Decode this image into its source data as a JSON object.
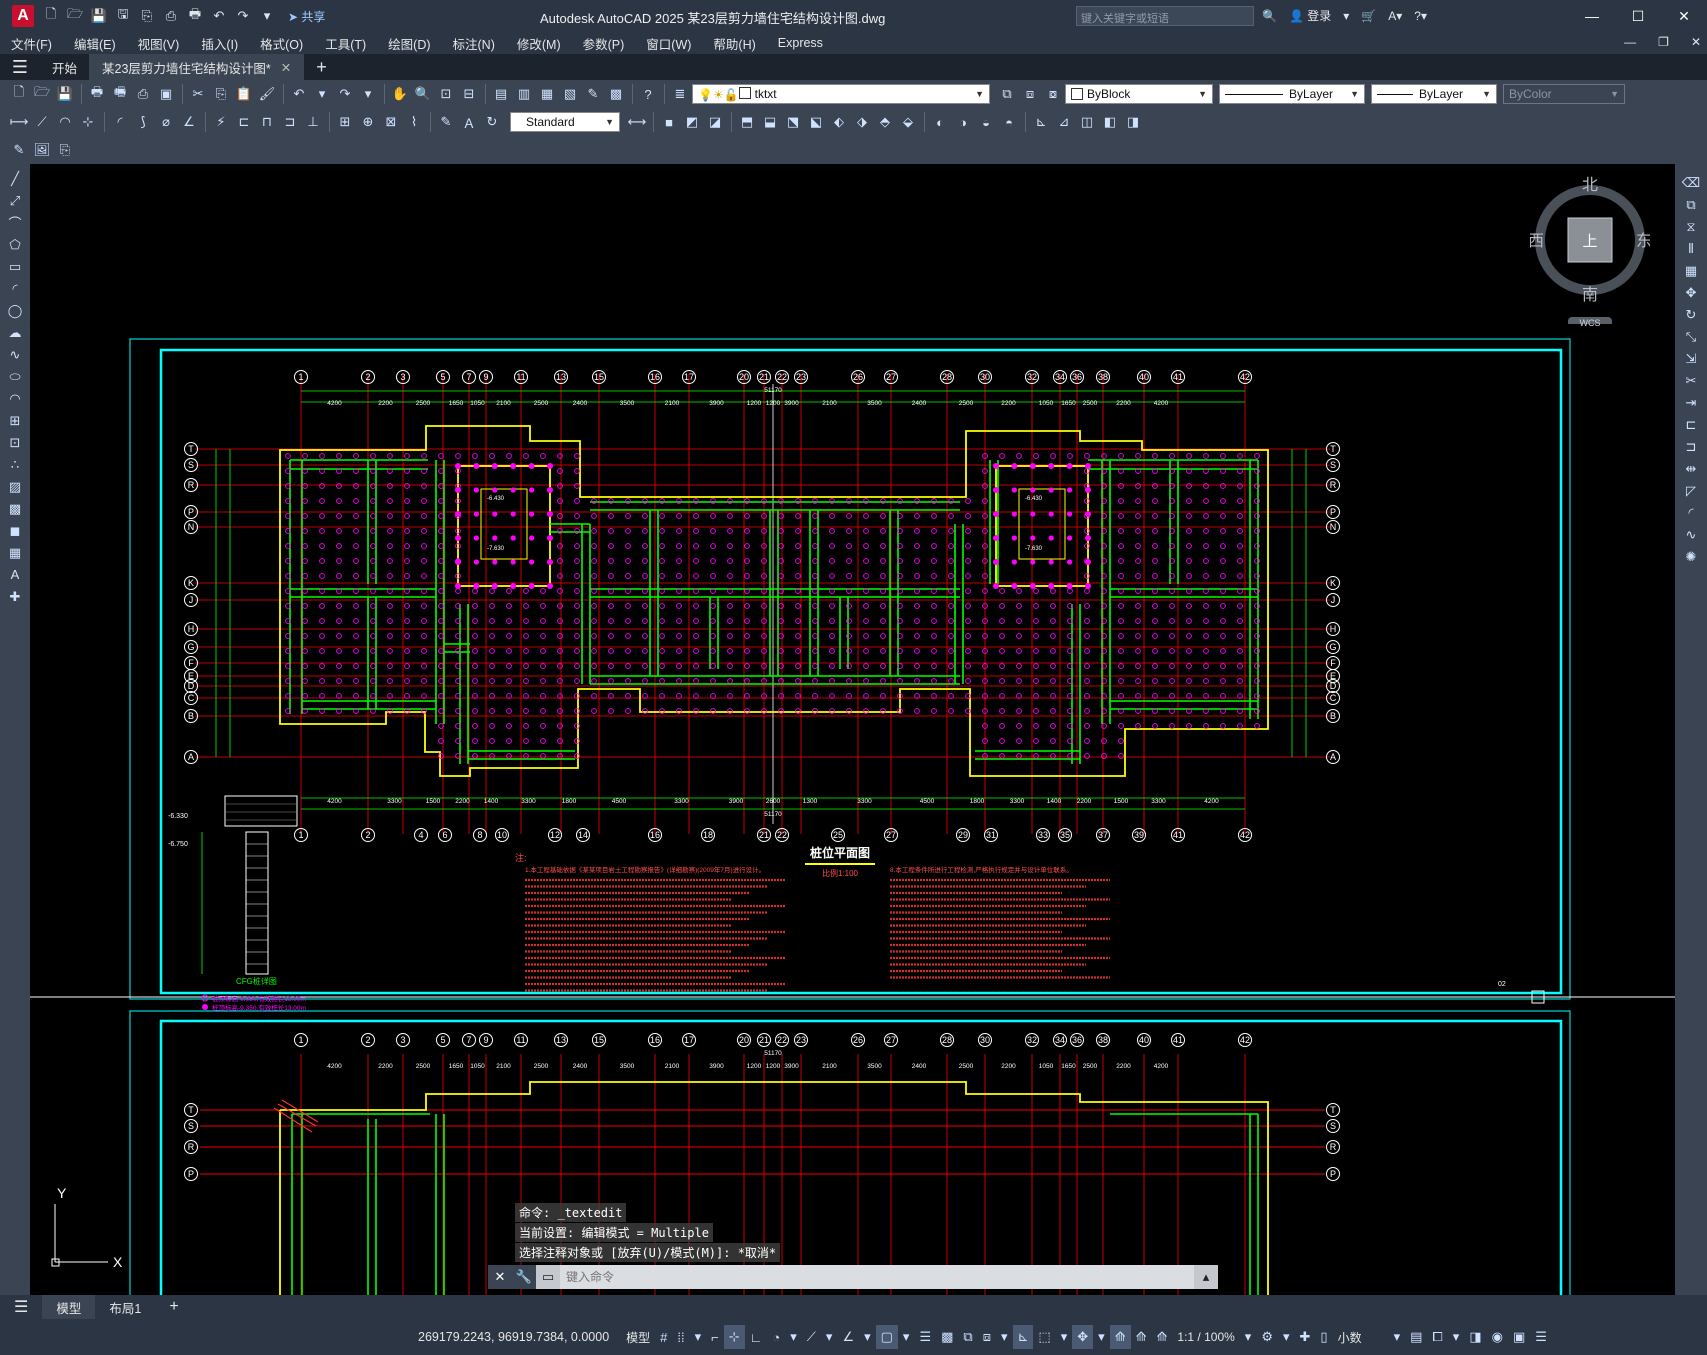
{
  "app": {
    "logo": "A",
    "window_title": "Autodesk AutoCAD 2025    某23层剪力墙住宅结构设计图.dwg",
    "share_label": "共享",
    "search_placeholder": "键入关键字或短语",
    "login_label": "登录"
  },
  "menus": [
    "文件(F)",
    "编辑(E)",
    "视图(V)",
    "插入(I)",
    "格式(O)",
    "工具(T)",
    "绘图(D)",
    "标注(N)",
    "修改(M)",
    "参数(P)",
    "窗口(W)",
    "帮助(H)",
    "Express"
  ],
  "file_tabs": [
    {
      "label": "开始"
    },
    {
      "label": "某23层剪力墙住宅结构设计图*"
    }
  ],
  "toolbar": {
    "layer_name": "tktxt",
    "color": "ByBlock",
    "linetype": "ByLayer",
    "lineweight": "ByLayer",
    "plotstyle": "ByColor",
    "text_style": "Standard"
  },
  "viewcube": {
    "north": "北",
    "south": "南",
    "east": "东",
    "west": "西",
    "face": "上",
    "wcs": "WCS"
  },
  "drawing": {
    "grid_top": [
      "1",
      "2",
      "3",
      "5",
      "7",
      "9",
      "11",
      "13",
      "15",
      "16",
      "17",
      "20",
      "21",
      "22",
      "23",
      "26",
      "27",
      "28",
      "30",
      "32",
      "34",
      "36",
      "38",
      "40",
      "41",
      "42"
    ],
    "grid_bottom": [
      "1",
      "2",
      "4",
      "6",
      "8",
      "10",
      "12",
      "14",
      "16",
      "18",
      "21",
      "22",
      "25",
      "27",
      "29",
      "31",
      "33",
      "35",
      "37",
      "39",
      "41",
      "42"
    ],
    "grid_rows": [
      "T",
      "S",
      "R",
      "P",
      "N",
      "K",
      "J",
      "H",
      "G",
      "F",
      "E",
      "D",
      "C",
      "B",
      "A"
    ],
    "dims_top": [
      "4200",
      "2200",
      "2500",
      "1650",
      "1050",
      "2100",
      "2500",
      "2400",
      "3500",
      "2100",
      "3900",
      "1200",
      "1200",
      "3900",
      "2100",
      "3500",
      "2400",
      "2500",
      "2200",
      "1050",
      "1650",
      "2500",
      "2200",
      "4200"
    ],
    "dims_bottom": [
      "4200",
      "3300",
      "1500",
      "2200",
      "1400",
      "3300",
      "1800",
      "4500",
      "3300",
      "3900",
      "2600",
      "1300",
      "3300",
      "4500",
      "1800",
      "3300",
      "1400",
      "2200",
      "1500",
      "3300",
      "4200"
    ],
    "total_width": "51170",
    "plan_title": "桩位平面图",
    "plan_scale": "比例1:100",
    "notes_heading": "注:",
    "note_a": "1.本工程基础依据《某某项目岩土工程勘察报告》(详细勘察)(2009年7月)进行设计。",
    "note_b": "8.本工程条件所进行工程检测,严格执行规定并与设计单位联系。",
    "legend_title": "CFG桩详图",
    "legend_1": "桩顶标高-6.650,有效桩长13.00m",
    "legend_2": "桩顶标高-9.350,有效桩长13.00m",
    "elev_1": "-6.330",
    "elev_2": "-6.750",
    "pit_label_1": "-6.430",
    "pit_label_2": "-7.630",
    "sheet_no": "02"
  },
  "command_history": [
    "命令: _textedit",
    "当前设置: 编辑模式 = Multiple",
    "选择注释对象或 [放弃(U)/模式(M)]: *取消*"
  ],
  "command_placeholder": "键入命令",
  "layout_tabs": [
    "模型",
    "布局1"
  ],
  "status": {
    "coordinates": "269179.2243, 96919.7384, 0.0000",
    "space": "模型",
    "scale": "1:1 / 100%",
    "units": "小数"
  },
  "colors": {
    "canvas": "#000000",
    "wall": "#00ff00",
    "outline": "#ffff00",
    "grid": "#ff0000",
    "pile": "#ff00ff",
    "frame": "#00ffff"
  }
}
